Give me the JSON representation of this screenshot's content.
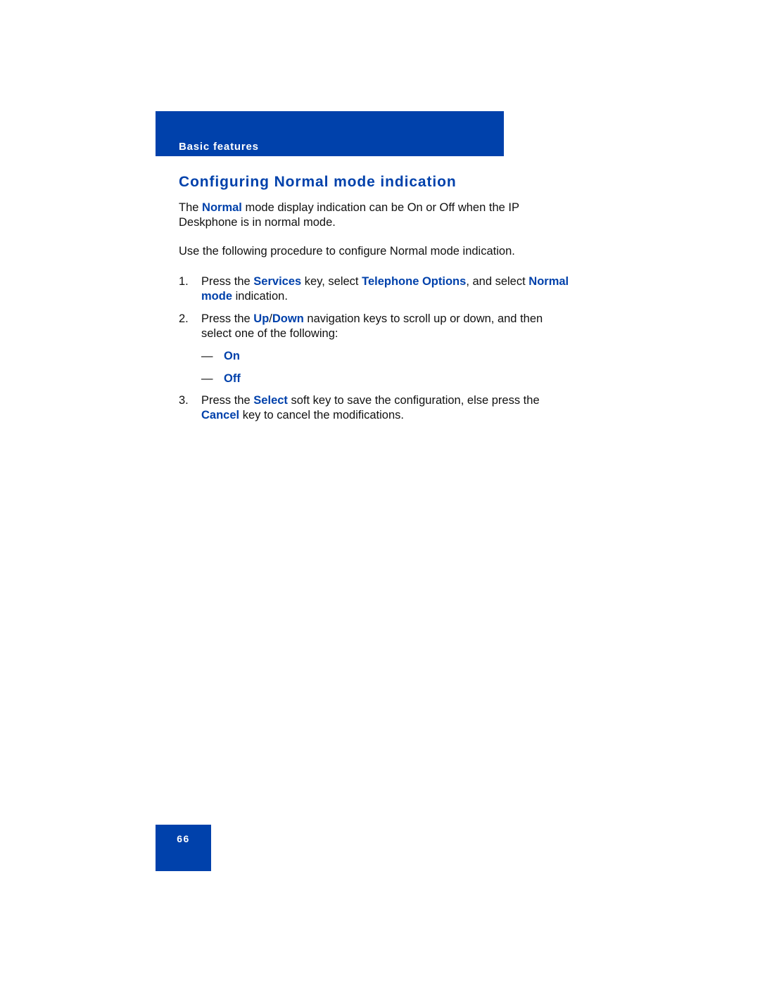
{
  "header": {
    "section_label": "Basic features"
  },
  "title": "Configuring Normal mode indication",
  "intro": {
    "p1_before": "The ",
    "p1_hl": "Normal",
    "p1_after": " mode display indication can be On or Off when the IP Deskphone is in normal mode.",
    "p2": "Use the following procedure to configure Normal mode indication."
  },
  "steps": [
    {
      "num": "1.",
      "t1": "Press the ",
      "h1": "Services",
      "t2": " key, select ",
      "h2": "Telephone Options",
      "t3": ", and select ",
      "h3": "Normal mode",
      "t4": " indication."
    },
    {
      "num": "2.",
      "t1": "Press the ",
      "h1": "Up",
      "t2": "/",
      "h2": "Down",
      "t3": " navigation keys to scroll up or down, and then select one of the following:"
    },
    {
      "num": "3.",
      "t1": "Press the ",
      "h1": "Select",
      "t2": " soft key to save the configuration, else press the ",
      "h2": "Cancel",
      "t3": " key to cancel the modifications."
    }
  ],
  "options": [
    {
      "dash": "—",
      "label": "On"
    },
    {
      "dash": "—",
      "label": "Off"
    }
  ],
  "footer": {
    "page_number": "66"
  },
  "colors": {
    "brand_blue": "#0041ab",
    "text": "#111111",
    "background": "#ffffff"
  }
}
